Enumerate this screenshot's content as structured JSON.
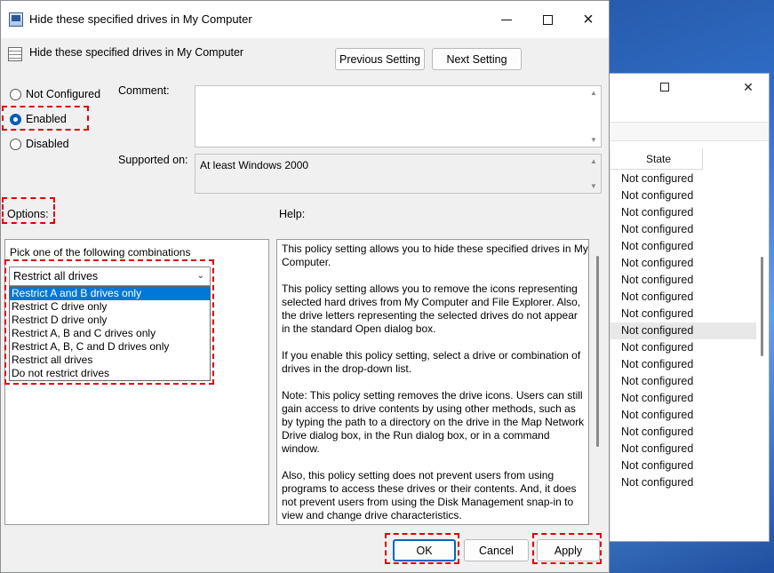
{
  "dialog": {
    "title": "Hide these specified drives in My Computer",
    "header": "Hide these specified drives in My Computer",
    "window_controls": {
      "minimize": "minimize",
      "maximize": "maximize",
      "close": "×"
    }
  },
  "nav": {
    "previous": "Previous Setting",
    "next": "Next Setting"
  },
  "state_options": [
    {
      "label": "Not Configured",
      "checked": false
    },
    {
      "label": "Enabled",
      "checked": true
    },
    {
      "label": "Disabled",
      "checked": false
    }
  ],
  "comment": {
    "label": "Comment:",
    "value": ""
  },
  "supported_on": {
    "label": "Supported on:",
    "value": "At least Windows 2000"
  },
  "options": {
    "label": "Options:",
    "prompt": "Pick one of the following combinations",
    "selected": "Restrict all drives",
    "items": [
      "Restrict A and B drives only",
      "Restrict C drive only",
      "Restrict D drive only",
      "Restrict A, B and C drives only",
      "Restrict A, B, C and D drives only",
      "Restrict all drives",
      "Do not restrict drives"
    ],
    "highlighted_index": 0
  },
  "help": {
    "label": "Help:",
    "paragraphs": [
      "This policy setting allows you to hide these specified drives in My Computer.",
      "This policy setting allows you to remove the icons representing selected hard drives from My Computer and File Explorer. Also, the drive letters representing the selected drives do not appear in the standard Open dialog box.",
      "If you enable this policy setting, select a drive or combination of drives in the drop-down list.",
      "Note: This policy setting removes the drive icons. Users can still gain access to drive contents by using other methods, such as by typing the path to a directory on the drive in the Map Network Drive dialog box, in the Run dialog box, or in a command window.",
      "Also, this policy setting does not prevent users from using programs to access these drives or their contents. And, it does not prevent users from using the Disk Management snap-in to view and change drive characteristics."
    ]
  },
  "buttons": {
    "ok": "OK",
    "cancel": "Cancel",
    "apply": "Apply"
  },
  "background_window": {
    "column_header": "State",
    "rows": [
      "Not configured",
      "Not configured",
      "Not configured",
      "Not configured",
      "Not configured",
      "Not configured",
      "Not configured",
      "Not configured",
      "Not configured",
      "Not configured",
      "Not configured",
      "Not configured",
      "Not configured",
      "Not configured",
      "Not configured",
      "Not configured",
      "Not configured",
      "Not configured",
      "Not configured"
    ],
    "selected_index": 9
  },
  "colors": {
    "accent": "#0078d7",
    "highlight": "#e00000"
  }
}
